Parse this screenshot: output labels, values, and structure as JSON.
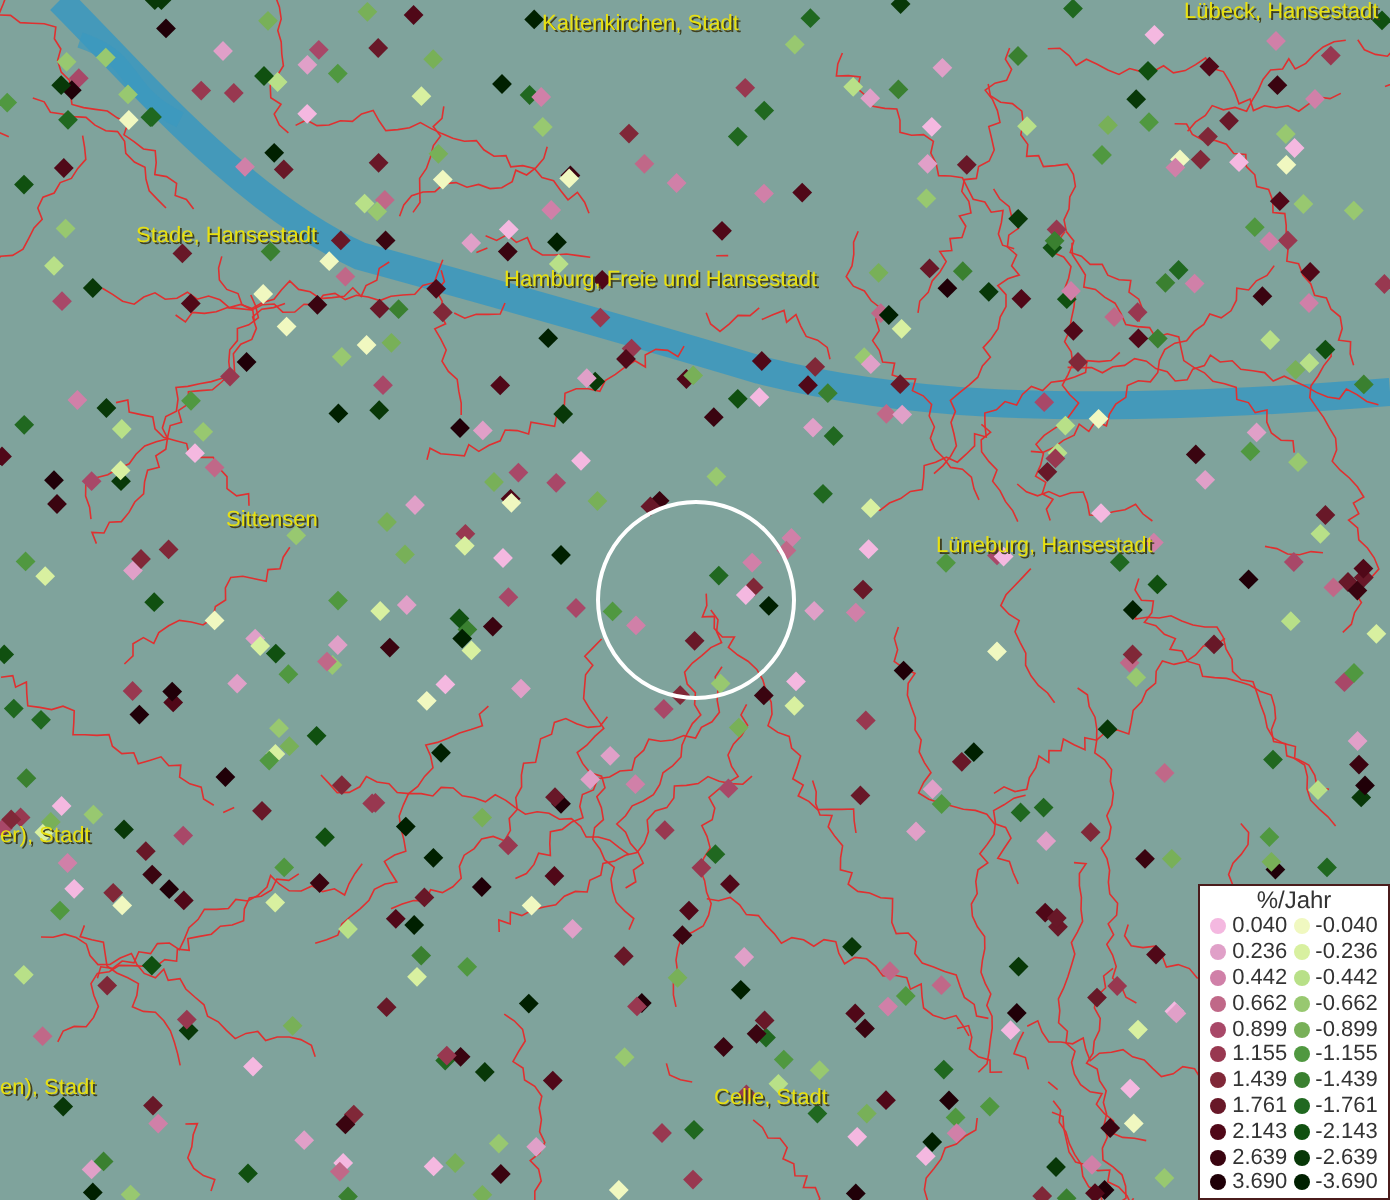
{
  "map": {
    "place_labels": [
      {
        "label": "Kaltenkirchen, Stadt"
      },
      {
        "label": "Lübeck, Hansestadt"
      },
      {
        "label": "Stade, Hansestadt"
      },
      {
        "label": "Hamburg, Freie und Hansestadt"
      },
      {
        "label": "Sittensen"
      },
      {
        "label": "Lüneburg, Hansestadt"
      },
      {
        "label": "er), Stadt"
      },
      {
        "label": "en), Stadt"
      },
      {
        "label": "Celle, Stadt"
      }
    ]
  },
  "legend": {
    "title": "%/Jahr",
    "columns": [
      {
        "items": [
          {
            "label": "0.040",
            "color": "#f4b8e0"
          },
          {
            "label": "0.236",
            "color": "#e0a0c8"
          },
          {
            "label": "0.442",
            "color": "#d080a8"
          },
          {
            "label": "0.662",
            "color": "#c06888"
          },
          {
            "label": "0.899",
            "color": "#a84868"
          },
          {
            "label": "1.155",
            "color": "#983850"
          },
          {
            "label": "1.439",
            "color": "#802838"
          },
          {
            "label": "1.761",
            "color": "#681828"
          },
          {
            "label": "2.143",
            "color": "#500818"
          },
          {
            "label": "2.639",
            "color": "#3a0410"
          },
          {
            "label": "3.690",
            "color": "#200008"
          }
        ]
      },
      {
        "items": [
          {
            "label": "-0.040",
            "color": "#f0f8c0"
          },
          {
            "label": "-0.236",
            "color": "#d8f0a0"
          },
          {
            "label": "-0.442",
            "color": "#b8e088"
          },
          {
            "label": "-0.662",
            "color": "#98c870"
          },
          {
            "label": "-0.899",
            "color": "#78b058"
          },
          {
            "label": "-1.155",
            "color": "#509840"
          },
          {
            "label": "-1.439",
            "color": "#3a8030"
          },
          {
            "label": "-1.761",
            "color": "#206820"
          },
          {
            "label": "-2.143",
            "color": "#105010"
          },
          {
            "label": "-2.639",
            "color": "#083808"
          },
          {
            "label": "-3.690",
            "color": "#002000"
          }
        ]
      }
    ]
  }
}
